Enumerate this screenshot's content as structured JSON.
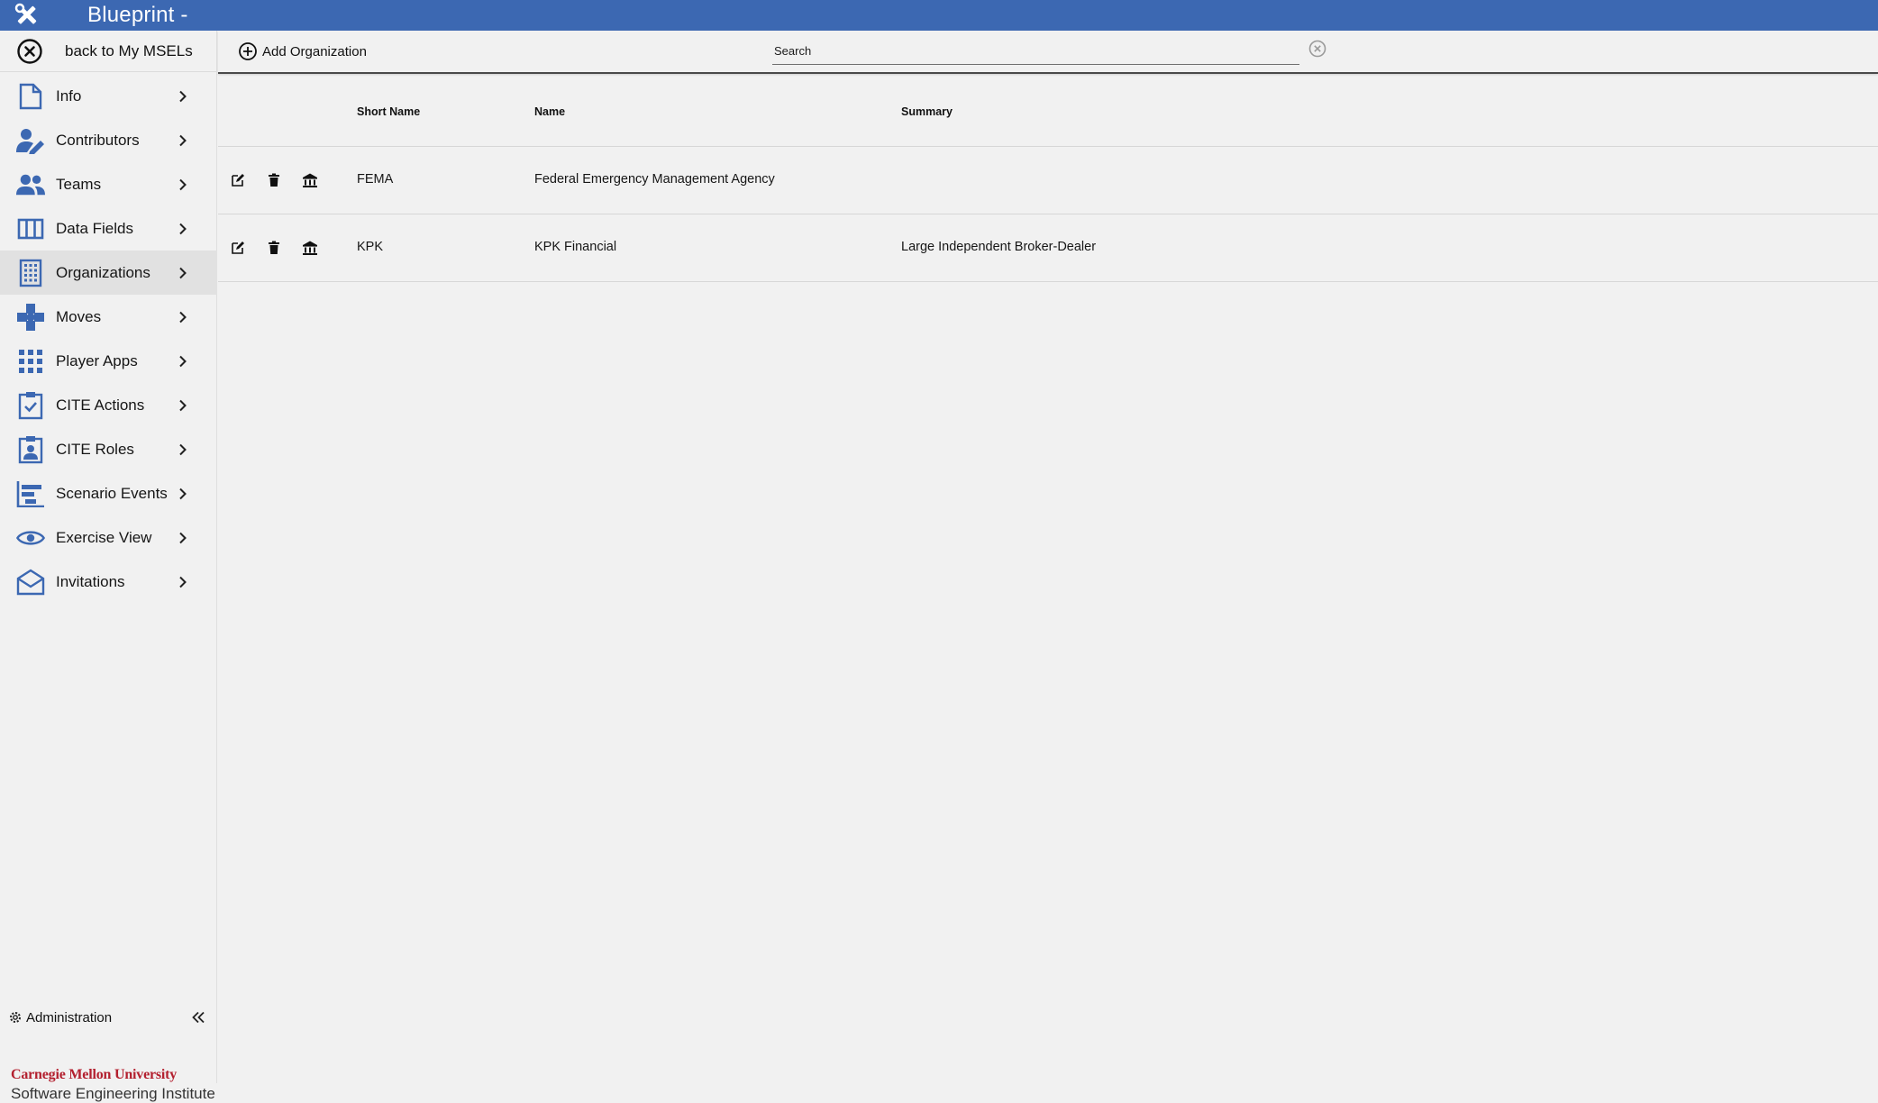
{
  "app": {
    "title": "Blueprint -",
    "brand_color": "#3c68b2"
  },
  "sidebar": {
    "back_label": "back to My MSELs",
    "items": [
      {
        "label": "Info",
        "icon": "document-icon"
      },
      {
        "label": "Contributors",
        "icon": "person-edit-icon"
      },
      {
        "label": "Teams",
        "icon": "people-icon"
      },
      {
        "label": "Data Fields",
        "icon": "columns-icon"
      },
      {
        "label": "Organizations",
        "icon": "building-icon",
        "active": true
      },
      {
        "label": "Moves",
        "icon": "moves-icon"
      },
      {
        "label": "Player Apps",
        "icon": "apps-grid-icon"
      },
      {
        "label": "CITE Actions",
        "icon": "clipboard-check-icon"
      },
      {
        "label": "CITE Roles",
        "icon": "clipboard-person-icon"
      },
      {
        "label": "Scenario Events",
        "icon": "timeline-icon"
      },
      {
        "label": "Exercise View",
        "icon": "eye-icon"
      },
      {
        "label": "Invitations",
        "icon": "envelope-icon"
      }
    ],
    "admin_label": "Administration",
    "brand_line1": "Carnegie Mellon University",
    "brand_line2": "Software Engineering Institute"
  },
  "toolbar": {
    "add_label": "Add Organization",
    "search_placeholder": "Search",
    "search_value": ""
  },
  "table": {
    "columns": {
      "short_name": "Short Name",
      "name": "Name",
      "summary": "Summary"
    },
    "rows": [
      {
        "short_name": "FEMA",
        "name": "Federal Emergency Management Agency",
        "summary": ""
      },
      {
        "short_name": "KPK",
        "name": "KPK Financial",
        "summary": "Large Independent Broker-Dealer"
      }
    ]
  }
}
